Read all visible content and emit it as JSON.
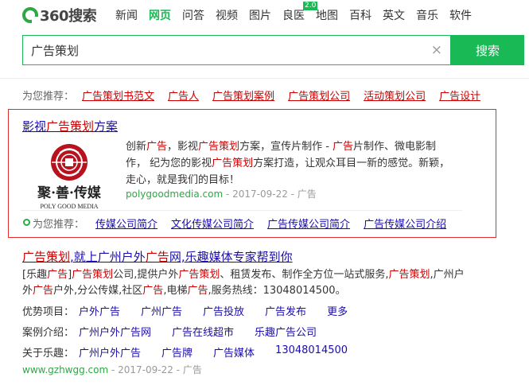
{
  "header": {
    "logo_text": "360搜索",
    "nav": [
      "新闻",
      "网页",
      "问答",
      "视频",
      "图片",
      "良医",
      "地图",
      "百科",
      "英文",
      "音乐",
      "软件"
    ],
    "badge": "2.0"
  },
  "search": {
    "query": "广告策划",
    "button": "搜索",
    "clear": "×"
  },
  "recommend": {
    "label": "为您推荐：",
    "links": [
      "广告策划书范文",
      "广告人",
      "广告策划案例",
      "广告策划公司",
      "活动策划公司",
      "广告设计"
    ]
  },
  "ad": {
    "title_pre": "影视",
    "title_hl": "广告策划",
    "title_post": "方案",
    "logo_cn": "聚·善·传媒",
    "logo_en": "POLY GOOD MEDIA",
    "desc": [
      {
        "t": "创新"
      },
      {
        "t": "广告",
        "h": 1
      },
      {
        "t": "，影视"
      },
      {
        "t": "广告策划",
        "h": 1
      },
      {
        "t": "方案，宣传片制作 - "
      },
      {
        "t": "广告",
        "h": 1
      },
      {
        "t": "片制作、微电影制作，  纪为您的影视"
      },
      {
        "t": "广告策划",
        "h": 1
      },
      {
        "t": "方案打造，让观众耳目一新的感觉。新颖，走心，就是我们的目标！"
      }
    ],
    "url": "polygoodmedia.com",
    "date": " - 2017-09-22 - ",
    "tag": "广告",
    "rec_label": "为您推荐：",
    "rec_links": [
      "传媒公司简介",
      "文化传媒公司简介",
      "广告传媒公司简介",
      "广告传媒公司介绍"
    ]
  },
  "result2": {
    "title": [
      {
        "t": "广告策划",
        "h": 1
      },
      {
        "t": ",就上广州户外"
      },
      {
        "t": "广告",
        "h": 1
      },
      {
        "t": "网,乐趣媒体专家帮到你"
      }
    ],
    "desc": [
      {
        "t": "[乐趣"
      },
      {
        "t": "广告",
        "h": 1
      },
      {
        "t": "]"
      },
      {
        "t": "广告策划",
        "h": 1
      },
      {
        "t": "公司,提供户外"
      },
      {
        "t": "广告策划",
        "h": 1
      },
      {
        "t": "、租赁发布、制作全方位一站式服务,"
      },
      {
        "t": "广告策划",
        "h": 1
      },
      {
        "t": ",广州户外"
      },
      {
        "t": "广告",
        "h": 1
      },
      {
        "t": "户外,分公传媒,社区"
      },
      {
        "t": "广告",
        "h": 1
      },
      {
        "t": ",电梯"
      },
      {
        "t": "广告",
        "h": 1
      },
      {
        "t": ",服务热线：13048014500。"
      }
    ],
    "rows": [
      {
        "label": "优势项目：",
        "links": [
          "户外广告",
          "广州广告",
          "广告投放",
          "广告发布",
          "更多"
        ]
      },
      {
        "label": "案例介绍：",
        "links": [
          "广州户外广告网",
          "广告在线超市",
          "乐趣广告公司"
        ]
      },
      {
        "label": "关于乐趣：",
        "links": [
          "广州户外广告",
          "广告牌",
          "广告媒体",
          "13048014500"
        ]
      }
    ],
    "url": "www.gzhwgg.com",
    "date": " - 2017-09-22 - ",
    "tag": "广告"
  }
}
